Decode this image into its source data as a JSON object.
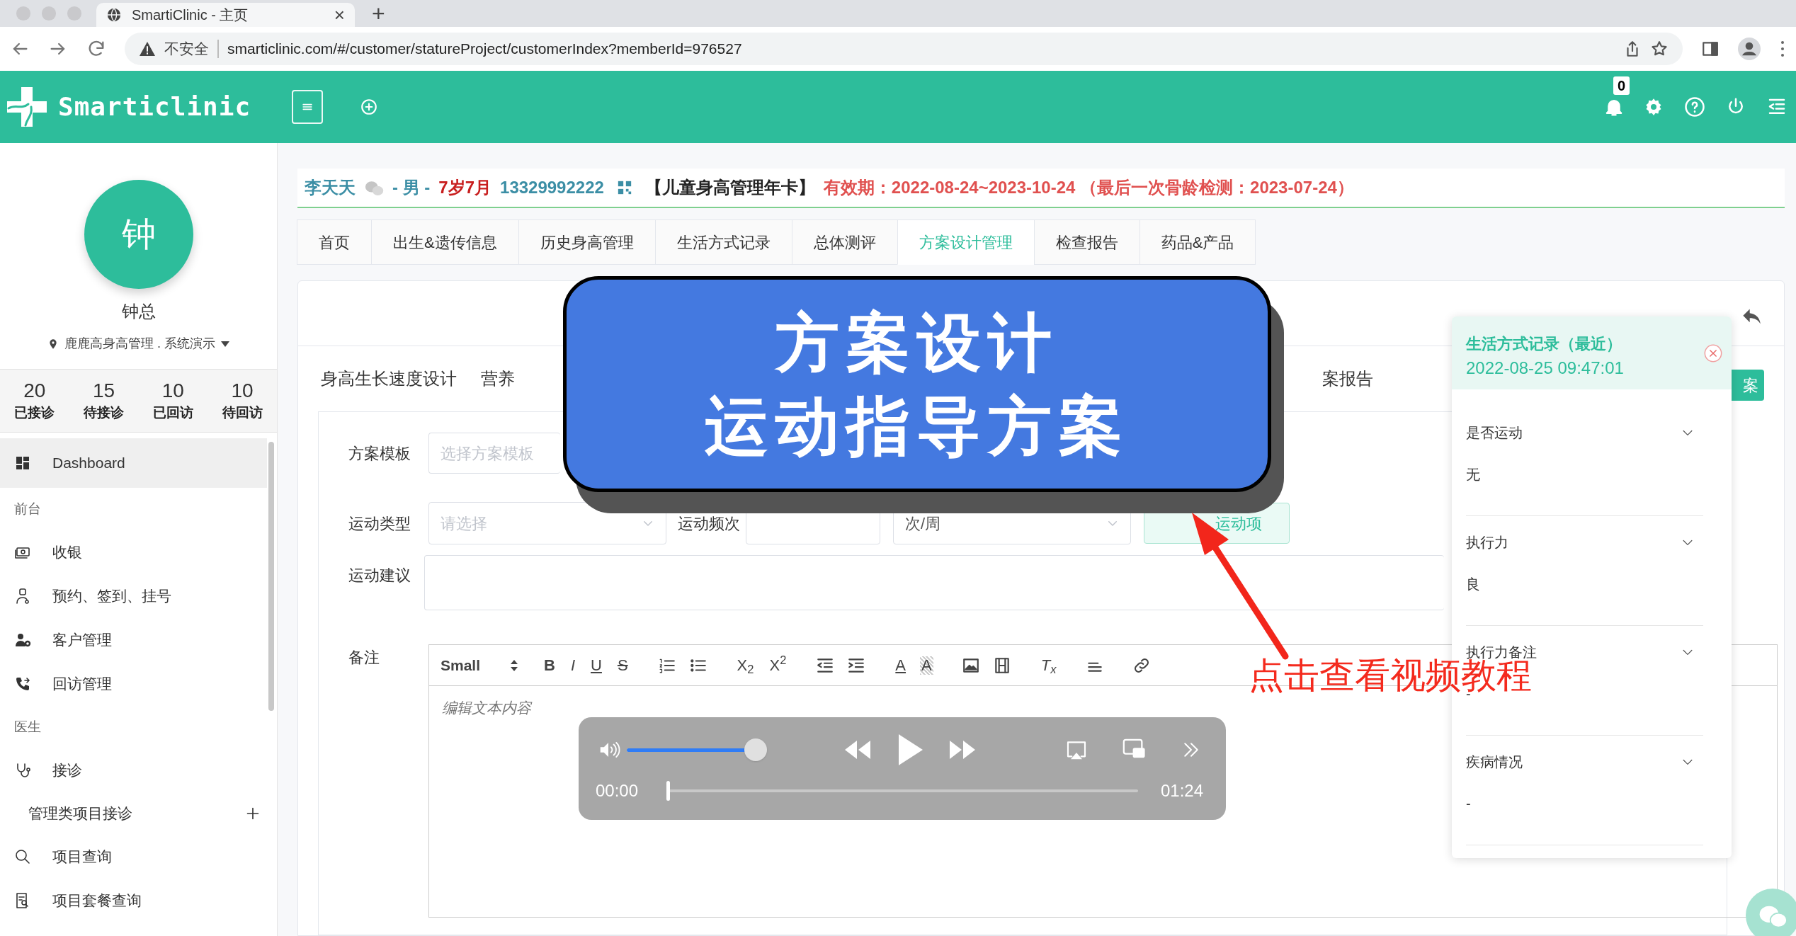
{
  "browser": {
    "tab_title": "SmartiClinic - 主页",
    "tab_close": "×",
    "new_tab": "+",
    "security": "不安全",
    "url": "smarticlinic.com/#/customer/statureProject/customerIndex?memberId=976527"
  },
  "header": {
    "logo": "Smarticlinic",
    "notification_count": "0"
  },
  "sidebar": {
    "avatar": "钟",
    "user": "钟总",
    "location": "鹿鹿高身高管理 . 系统演示",
    "stats": [
      {
        "value": "20",
        "label": "已接诊"
      },
      {
        "value": "15",
        "label": "待接诊"
      },
      {
        "value": "10",
        "label": "已回访"
      },
      {
        "value": "10",
        "label": "待回访"
      }
    ],
    "items": [
      {
        "kind": "item",
        "label": "Dashboard",
        "selected": true
      },
      {
        "kind": "section",
        "label": "前台"
      },
      {
        "kind": "item",
        "label": "收银",
        "selected": false
      },
      {
        "kind": "item",
        "label": "预约、签到、挂号",
        "selected": false
      },
      {
        "kind": "item",
        "label": "客户管理",
        "selected": false
      },
      {
        "kind": "item",
        "label": "回访管理",
        "selected": false
      },
      {
        "kind": "section",
        "label": "医生"
      },
      {
        "kind": "item",
        "label": "接诊",
        "selected": false
      },
      {
        "kind": "subitem",
        "label": "管理类项目接诊",
        "selected": false
      },
      {
        "kind": "item",
        "label": "项目查询",
        "selected": false
      },
      {
        "kind": "item",
        "label": "项目套餐查询",
        "selected": false
      }
    ]
  },
  "patient": [
    {
      "text": "李天天",
      "color": "#3b8ea5"
    },
    {
      "text": "- 男 -",
      "color": "#3b8ea5"
    },
    {
      "text": "7岁7月",
      "color": "#c81e1e"
    },
    {
      "text": "13329992222",
      "color": "#3b8ea5"
    },
    {
      "text": "【儿童身高管理年卡】",
      "color": "#222222"
    },
    {
      "text": "有效期：2022-08-24~2023-10-24 （最后一次骨龄检测：2023-07-24）",
      "color": "#e0504f"
    }
  ],
  "tabs": [
    {
      "label": "首页",
      "selected": false
    },
    {
      "label": "出生&遗传信息",
      "selected": false
    },
    {
      "label": "历史身高管理",
      "selected": false
    },
    {
      "label": "生活方式记录",
      "selected": false
    },
    {
      "label": "总体测评",
      "selected": false
    },
    {
      "label": "方案设计管理",
      "selected": true
    },
    {
      "label": "检查报告",
      "selected": false
    },
    {
      "label": "药品&产品",
      "selected": false
    }
  ],
  "sub_tabs": [
    "身高生长速度设计",
    "营养",
    "案报告"
  ],
  "side_button": "案",
  "form": {
    "template_label": "方案模板",
    "template_placeholder": "选择方案模板",
    "type_label": "运动类型",
    "type_placeholder": "请选择",
    "freq_label": "运动频次",
    "unit_value": "次/周",
    "add_button": "运动项",
    "advice_label": "运动建议",
    "note_label": "备注",
    "editor": {
      "font_size": "Small",
      "placeholder": "编辑文本内容",
      "toolbar": [
        [
          {
            "kind": "bold",
            "glyph": "B"
          },
          {
            "kind": "italic",
            "glyph": "I"
          },
          {
            "kind": "underline",
            "glyph": "U"
          },
          {
            "kind": "strike",
            "glyph": "S"
          }
        ],
        [
          {
            "kind": "ordered-list"
          },
          {
            "kind": "bullet-list"
          }
        ],
        [
          {
            "kind": "script",
            "glyph": "X$_{2}$"
          },
          {
            "kind": "script",
            "glyph": "X$^{2}$"
          }
        ],
        [
          {
            "kind": "outdent"
          },
          {
            "kind": "indent"
          }
        ],
        [
          {
            "kind": "font-color",
            "glyph": "A"
          },
          {
            "kind": "background-color",
            "glyph": "A"
          }
        ],
        [
          {
            "kind": "image"
          },
          {
            "kind": "video"
          }
        ],
        [
          {
            "kind": "clear",
            "glyph": "T$_{x}$"
          }
        ],
        [
          {
            "kind": "align"
          }
        ],
        [
          {
            "kind": "link"
          }
        ]
      ]
    }
  },
  "banner": {
    "lines": [
      "方案设计",
      "运动指导方案"
    ]
  },
  "video": {
    "playing": false,
    "volume": {
      "level": 1
    },
    "elapsed": "00:00",
    "duration": "01:24",
    "progress": {
      "level": 0
    }
  },
  "callout": "点击查看视频教程",
  "lifestyle_panel": {
    "title": "生活方式记录（最近）",
    "time": "2022-08-25 09:47:01",
    "fields": [
      {
        "label": "是否运动",
        "value": "无"
      },
      {
        "label": "执行力",
        "value": "良"
      },
      {
        "label": "执行力备注",
        "value": "-"
      },
      {
        "label": "疾病情况",
        "value": "-"
      }
    ]
  }
}
